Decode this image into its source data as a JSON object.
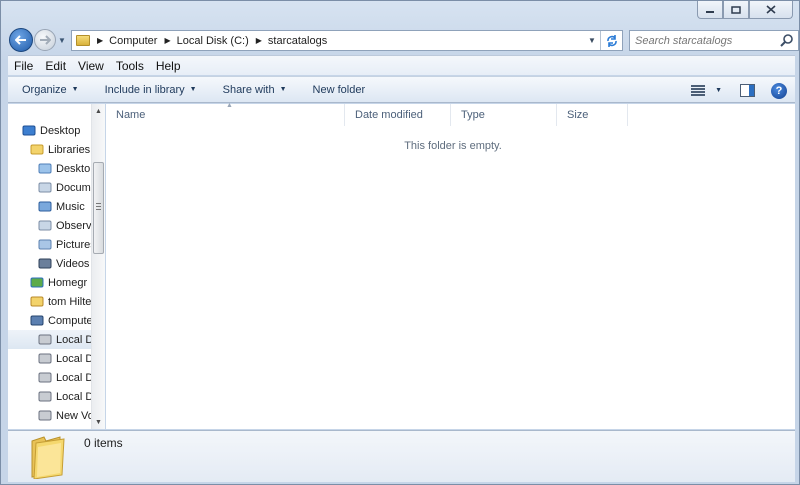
{
  "window": {
    "caption_buttons": [
      "minimize",
      "maximize",
      "close"
    ]
  },
  "address_bar": {
    "crumbs": [
      "Computer",
      "Local Disk (C:)",
      "starcatalogs"
    ],
    "search_placeholder": "Search starcatalogs"
  },
  "menu": [
    "File",
    "Edit",
    "View",
    "Tools",
    "Help"
  ],
  "toolbar": {
    "organize": "Organize",
    "include_in_library": "Include in library",
    "share_with": "Share with",
    "new_folder": "New folder"
  },
  "navigation": [
    {
      "label": "Desktop",
      "icon": "desktop-icon",
      "indent": 0,
      "selected": false
    },
    {
      "label": "Libraries",
      "icon": "libraries-icon",
      "indent": 1,
      "selected": false
    },
    {
      "label": "Deskto",
      "icon": "desktop-library-icon",
      "indent": 2,
      "selected": false
    },
    {
      "label": "Docum",
      "icon": "documents-icon",
      "indent": 2,
      "selected": false
    },
    {
      "label": "Music",
      "icon": "music-icon",
      "indent": 2,
      "selected": false
    },
    {
      "label": "Observ",
      "icon": "library-folder-icon",
      "indent": 2,
      "selected": false
    },
    {
      "label": "Pictures",
      "icon": "pictures-icon",
      "indent": 2,
      "selected": false
    },
    {
      "label": "Videos",
      "icon": "videos-icon",
      "indent": 2,
      "selected": false
    },
    {
      "label": "Homegr",
      "icon": "homegroup-icon",
      "indent": 1,
      "selected": false
    },
    {
      "label": "tom Hilte",
      "icon": "user-folder-icon",
      "indent": 1,
      "selected": false
    },
    {
      "label": "Compute",
      "icon": "computer-icon",
      "indent": 1,
      "selected": false
    },
    {
      "label": "Local D",
      "icon": "local-disk-icon",
      "indent": 2,
      "selected": true
    },
    {
      "label": "Local D",
      "icon": "drive-icon",
      "indent": 2,
      "selected": false
    },
    {
      "label": "Local D",
      "icon": "drive-icon",
      "indent": 2,
      "selected": false
    },
    {
      "label": "Local D",
      "icon": "drive-icon",
      "indent": 2,
      "selected": false
    },
    {
      "label": "New Vo",
      "icon": "drive-icon",
      "indent": 2,
      "selected": false
    }
  ],
  "columns": [
    "Name",
    "Date modified",
    "Type",
    "Size"
  ],
  "empty_message": "This folder is empty.",
  "details": {
    "items_count": "0 items"
  },
  "colors": {
    "accent": "#1f5aa8",
    "toolbar_text": "#1e395b",
    "header_text": "#4c607a"
  }
}
